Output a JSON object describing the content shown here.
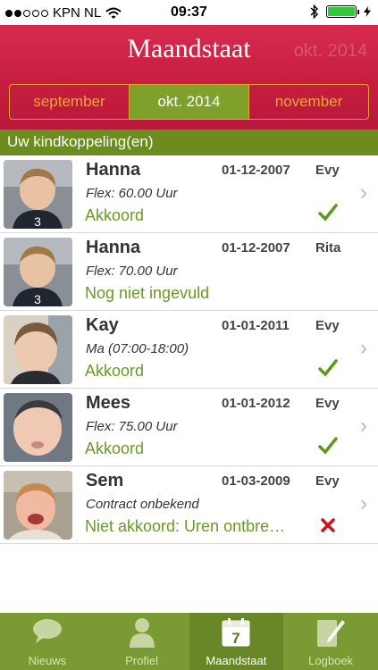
{
  "status_bar": {
    "carrier": "KPN NL",
    "time": "09:37"
  },
  "header": {
    "title": "Maandstaat",
    "ghost_text": "okt. 2014"
  },
  "months": {
    "prev": "september",
    "current": "okt. 2014",
    "next": "november"
  },
  "section": {
    "title": "Uw kindkoppeling(en)"
  },
  "rows": [
    {
      "name": "Hanna",
      "date": "01-12-2007",
      "who": "Evy",
      "detail": "Flex: 60.00 Uur",
      "status": "Akkoord",
      "mark": "check",
      "chevron": true
    },
    {
      "name": "Hanna",
      "date": "01-12-2007",
      "who": "Rita",
      "detail": "Flex: 70.00 Uur",
      "status": "Nog niet ingevuld",
      "mark": "",
      "chevron": false
    },
    {
      "name": "Kay",
      "date": "01-01-2011",
      "who": "Evy",
      "detail": "Ma (07:00-18:00)",
      "status": "Akkoord",
      "mark": "check",
      "chevron": true
    },
    {
      "name": "Mees",
      "date": "01-01-2012",
      "who": "Evy",
      "detail": "Flex: 75.00 Uur",
      "status": "Akkoord",
      "mark": "check",
      "chevron": true
    },
    {
      "name": "Sem",
      "date": "01-03-2009",
      "who": "Evy",
      "detail": "Contract onbekend",
      "status": "Niet akkoord: Uren ontbre…",
      "mark": "cross",
      "chevron": true
    }
  ],
  "tabs": {
    "news": "Nieuws",
    "profile": "Profiel",
    "month": "Maandstaat",
    "log": "Logboek",
    "calendar_day": "7"
  },
  "colors": {
    "header": "#c51d3f",
    "accent_green": "#6c8c1f",
    "status_green": "#6a9a25",
    "segment_orange": "#e8a233",
    "cross_red": "#c8141c"
  }
}
